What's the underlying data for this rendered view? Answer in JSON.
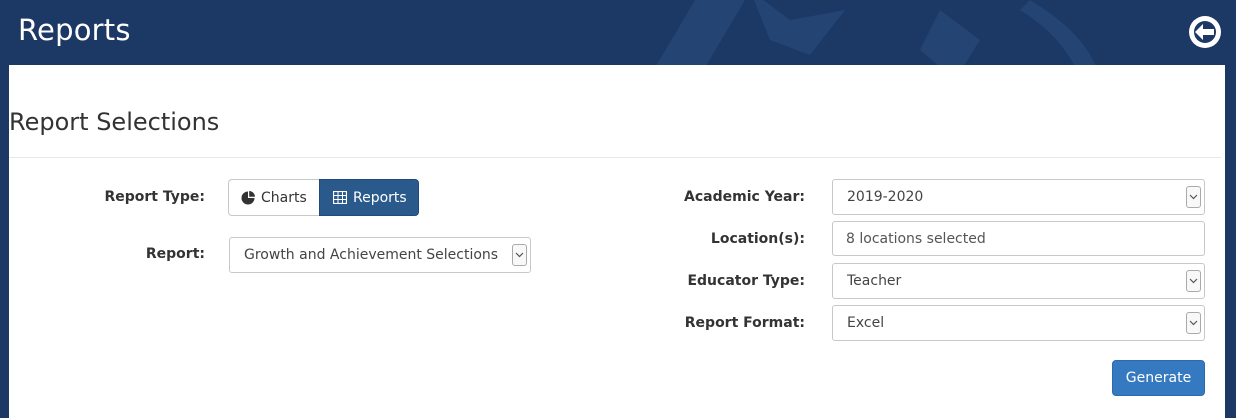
{
  "header": {
    "title": "Reports",
    "back_icon": "circle-arrow-left-icon"
  },
  "section": {
    "title": "Report Selections"
  },
  "form_left": {
    "report_type_label": "Report Type:",
    "report_type_options": [
      {
        "label": "Charts",
        "icon": "pie-chart-icon",
        "selected": false
      },
      {
        "label": "Reports",
        "icon": "table-icon",
        "selected": true
      }
    ],
    "report_label": "Report:",
    "report_value": "Growth and Achievement Selections"
  },
  "form_right": {
    "academic_year_label": "Academic Year:",
    "academic_year_value": "2019-2020",
    "locations_label": "Location(s):",
    "locations_value": "8 locations selected",
    "educator_type_label": "Educator Type:",
    "educator_type_value": "Teacher",
    "report_format_label": "Report Format:",
    "report_format_value": "Excel"
  },
  "actions": {
    "generate_label": "Generate"
  },
  "colors": {
    "header_bg": "#1c3864",
    "primary_button": "#3579c0",
    "toggle_active": "#2a5a8c"
  }
}
